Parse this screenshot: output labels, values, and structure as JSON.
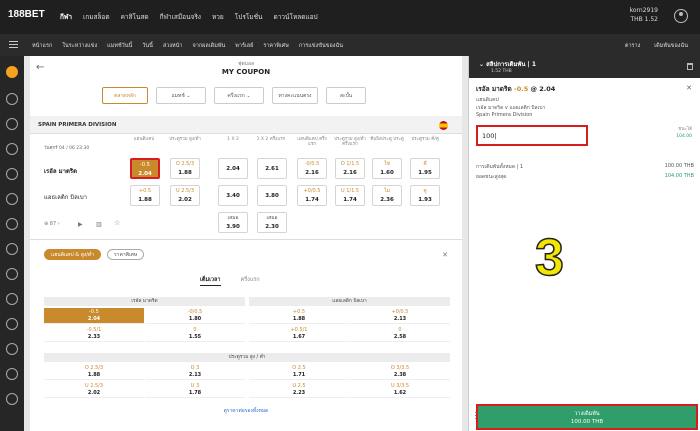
{
  "header": {
    "logo": "188BET",
    "nav": [
      "กีฬา",
      "เกมสล็อต",
      "คาสิโนสด",
      "กีฬาเสมือนจริง",
      "หวย",
      "โปรโมชั่น",
      "ดาวน์โหลดแอป"
    ],
    "username": "korn2919",
    "balance": "THB 1.52"
  },
  "subnav": {
    "items": [
      "หน้าแรก",
      "ในระหว่างแข่ง",
      "แมทช์วันนี้",
      "วันนี้",
      "ล่วงหน้า",
      "จากผลเดิมพัน",
      "พาร์เลย์",
      "ราคาพิเศษ",
      "การแข่งขันของฉัน"
    ],
    "right": [
      "ตาราง",
      "เดิมพันของฉัน"
    ]
  },
  "coupon": {
    "sub": "ฟุตบอล",
    "title": "MY COUPON",
    "filters": [
      "ตลาดหลัก",
      "แมทช์",
      "ครึ่งแรก",
      "ทางคะแนนตรง",
      "สะบั้น"
    ],
    "league": "SPAIN PRIMERA DIVISION",
    "columns": [
      "แฮนดิแคป",
      "ประตูรวม สูง/ต่ำ",
      "1 X 2",
      "1 X 2 ครึ่งแรก",
      "แฮนดิแคป ครึ่งแรก",
      "ประตูรวม สูง/ต่ำ ครึ่งแรก",
      "ทีมยิงประตู ประตู",
      "ประตูรวม คี่/คู่"
    ],
    "match_time": "วันศุกร์ 04 / 06 23:30",
    "home": "เรอัล มาดริด",
    "away": "แอธเลติก บิลเบา",
    "home_odds": [
      {
        "h": "-0.5",
        "o": "2.04"
      },
      {
        "h": "O 2.5/3",
        "o": "1.88"
      },
      {
        "h": "",
        "o": "2.04"
      },
      {
        "h": "",
        "o": "2.61"
      },
      {
        "h": "-0/0.5",
        "o": "2.16"
      },
      {
        "h": "O 1/1.5",
        "o": "2.16"
      },
      {
        "h": "ใช่",
        "o": "1.60"
      },
      {
        "h": "คี่",
        "o": "1.95"
      }
    ],
    "away_odds": [
      {
        "h": "+0.5",
        "o": "1.88"
      },
      {
        "h": "U 2.5/3",
        "o": "2.02"
      },
      {
        "h": "",
        "o": "3.40"
      },
      {
        "h": "",
        "o": "3.80"
      },
      {
        "h": "+0/0.5",
        "o": "1.74"
      },
      {
        "h": "U 1/1.5",
        "o": "1.74"
      },
      {
        "h": "ไม่",
        "o": "2.36"
      },
      {
        "h": "คู่",
        "o": "1.93"
      }
    ],
    "draw_odds": [
      {
        "h": "เสมอ",
        "o": "3.90"
      },
      {
        "h": "เสมอ",
        "o": "2.30"
      }
    ],
    "more_count": "87",
    "pill_on": "แฮนดิแคป & สูง/ต่ำ",
    "pill_off": "ราคาพิเศษ",
    "subtab_on": "เต็มเวลา",
    "subtab_off": "ครึ่งแรก",
    "table": {
      "head_home": "เรอัล มาดริด",
      "head_away": "แอธเลติก บิลเบา",
      "head_ou": "ประตูรวม สูง / ต่ำ",
      "hdp_rows": [
        [
          {
            "h": "-0.5",
            "o": "2.04"
          },
          {
            "h": "-0/0.5",
            "o": "1.80"
          },
          {
            "h": "+0.5",
            "o": "1.88"
          },
          {
            "h": "+0/0.5",
            "o": "2.13"
          }
        ],
        [
          {
            "h": "-0.5/1",
            "o": "2.33"
          },
          {
            "h": "0",
            "o": "1.55"
          },
          {
            "h": "+0.5/1",
            "o": "1.67"
          },
          {
            "h": "0",
            "o": "2.58"
          }
        ]
      ],
      "ou_rows": [
        [
          {
            "h": "O 2.5/3",
            "o": "1.88"
          },
          {
            "h": "O 3",
            "o": "2.13"
          },
          {
            "h": "O 2.5",
            "o": "1.71"
          },
          {
            "h": "O 3/3.5",
            "o": "2.38"
          }
        ],
        [
          {
            "h": "U 2.5/3",
            "o": "2.02"
          },
          {
            "h": "U 3",
            "o": "1.78"
          },
          {
            "h": "U 2.5",
            "o": "2.23"
          },
          {
            "h": "U 3/3.5",
            "o": "1.62"
          }
        ]
      ]
    },
    "more_link": "ดูราคาต่อรองทั้งหมด"
  },
  "slip": {
    "title": "สลิปการเดิมพัน",
    "count": "1",
    "balance": "1.52 THB",
    "selection": "เรอัล มาดริด",
    "handicap": "-0.5",
    "at": "@",
    "odds": "2.04",
    "market": "แฮนดิแคป",
    "fixture": "เรอัล มาดริด v แอธเลติก บิลเบา",
    "league": "Spain Primera Division",
    "stake": "100",
    "max_label": "ชนะได้",
    "max_value": "104.00",
    "total_label": "การเดิมพันทั้งหมด",
    "total_count": "1",
    "total_value": "100.00 THB",
    "payout_label": "ยอดชนะสูงสุด",
    "payout_value": "104.00 THB",
    "place_label": "วางเดิมพัน",
    "place_amount": "100.00 THB"
  },
  "overlay_number": "3",
  "colors": {
    "accent": "#c98a2d",
    "highlight": "#d91c1c",
    "place": "#2f9e6b",
    "overlay": "#f3e600"
  }
}
